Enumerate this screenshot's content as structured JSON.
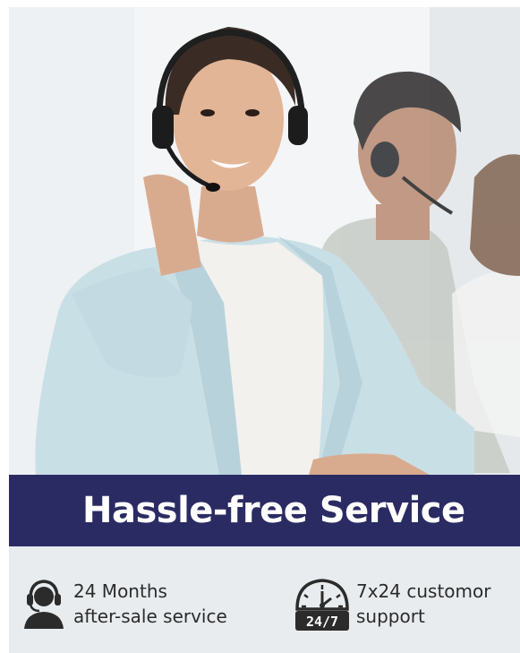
{
  "banner": {
    "title": "Hassle-free Service"
  },
  "features": [
    {
      "icon": "headset-agent-icon",
      "line1": "24 Months",
      "line2": "after-sale service"
    },
    {
      "icon": "clock-24-7-icon",
      "icon_text": "24/7",
      "line1": "7x24 customor",
      "line2": "support"
    }
  ],
  "colors": {
    "banner_bg": "#2b2b63",
    "features_bg": "#e9ecef",
    "text": "#2b2b2b"
  }
}
